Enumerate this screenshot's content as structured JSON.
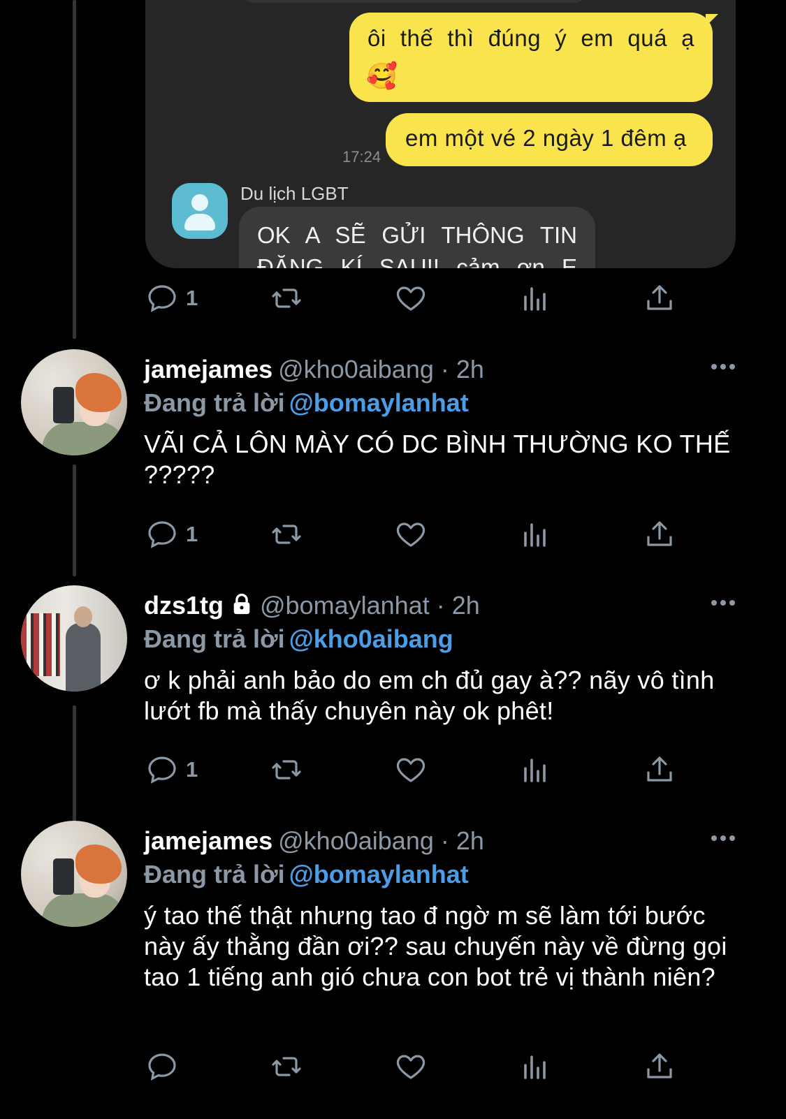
{
  "chat_screenshot": {
    "outgoing_1": "ôi thế thì đúng ý em quá ạ",
    "outgoing_1_emoji": "🥰",
    "outgoing_2": "em một vé 2 ngày 1 đêm ạ",
    "time": "17:24",
    "sender": "Du lịch LGBT",
    "incoming": "OK A SẼ GỬI THÔNG TIN ĐĂNG KÍ SAU!! cảm ơn E"
  },
  "actions_top": {
    "reply_count": "1"
  },
  "tweets": [
    {
      "name": "jamejames",
      "handle": "@kho0aibang · 2h",
      "replying_label": "Đang trả lời",
      "replying_to": "@bomaylanhat",
      "text": "VÃI CẢ LÔN MÀY CÓ DC BÌNH THƯỜNG KO THẾ ?????",
      "reply_count": "1"
    },
    {
      "name": "dzs1tg",
      "handle": "@bomaylanhat · 2h",
      "replying_label": "Đang trả lời",
      "replying_to": "@kho0aibang",
      "text": "ơ k phải anh bảo do em ch đủ gay à?? nãy vô tình lướt fb mà thấy chuyên này ok phêt!",
      "reply_count": "1"
    },
    {
      "name": "jamejames",
      "handle": "@kho0aibang · 2h",
      "replying_label": "Đang trả lời",
      "replying_to": "@bomaylanhat",
      "text": "ý tao thế thật nhưng tao đ ngờ m sẽ làm tới bước này ấy thằng đần ơi?? sau chuyến này về đừng gọi tao 1 tiếng anh gió chưa con bot trẻ vị thành niên?",
      "reply_count": ""
    }
  ],
  "icons": [
    "reply-icon",
    "retweet-icon",
    "like-icon",
    "views-icon",
    "share-icon",
    "more-icon",
    "lock-icon"
  ],
  "colors": {
    "background": "#000000",
    "bubble_out": "#f9e44d",
    "mention": "#4a9de6",
    "muted": "#8b98a5"
  }
}
